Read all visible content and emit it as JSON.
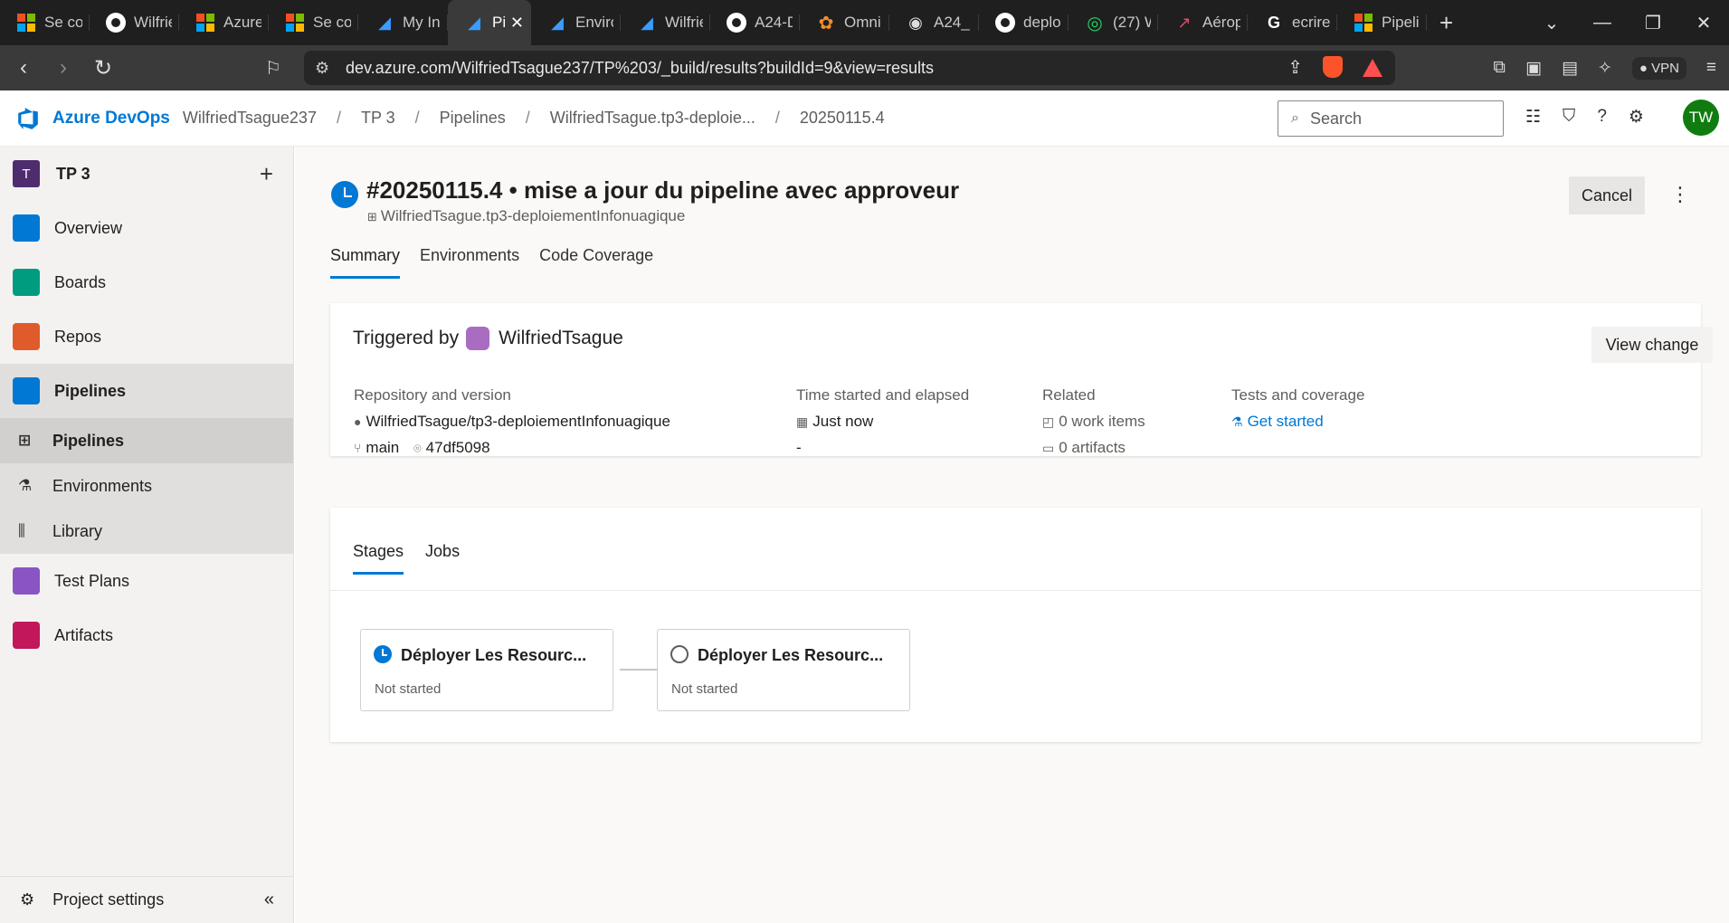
{
  "browser": {
    "tabs": [
      {
        "label": "Se cor",
        "icon": "microsoft-icon"
      },
      {
        "label": "Wilfrie",
        "icon": "github-icon"
      },
      {
        "label": "Azure",
        "icon": "microsoft-icon"
      },
      {
        "label": "Se cor",
        "icon": "microsoft-icon"
      },
      {
        "label": "My In",
        "icon": "azure-devops-icon"
      },
      {
        "label": "Pi",
        "icon": "azure-devops-icon",
        "active": true
      },
      {
        "label": "Enviro",
        "icon": "azure-devops-icon"
      },
      {
        "label": "Wilfrie",
        "icon": "azure-devops-icon"
      },
      {
        "label": "A24-D",
        "icon": "github-icon"
      },
      {
        "label": "Omni",
        "icon": "flower-icon"
      },
      {
        "label": "A24_",
        "icon": "globe-icon"
      },
      {
        "label": "deplo",
        "icon": "github-icon"
      },
      {
        "label": "(27) W",
        "icon": "whatsapp-icon"
      },
      {
        "label": "Aérop",
        "icon": "chart-icon"
      },
      {
        "label": "ecrire",
        "icon": "google-icon"
      },
      {
        "label": "Pipeli",
        "icon": "microsoft-icon"
      }
    ],
    "url": "dev.azure.com/WilfriedTsague237/TP%203/_build/results?buildId=9&view=results",
    "vpn_label": "VPN"
  },
  "header": {
    "brand": "Azure DevOps",
    "breadcrumbs": [
      "WilfriedTsague237",
      "TP 3",
      "Pipelines",
      "WilfriedTsague.tp3-deploie...",
      "20250115.4"
    ],
    "search_placeholder": "Search",
    "avatar_initials": "TW"
  },
  "sidebar": {
    "project_badge": "T",
    "project_name": "TP 3",
    "items": [
      {
        "label": "Overview",
        "color": "#0078d4"
      },
      {
        "label": "Boards",
        "color": "#009c7f"
      },
      {
        "label": "Repos",
        "color": "#e05b2b"
      },
      {
        "label": "Pipelines",
        "color": "#0078d4"
      }
    ],
    "sub_items": [
      {
        "label": "Pipelines"
      },
      {
        "label": "Environments"
      },
      {
        "label": "Library"
      }
    ],
    "items_after": [
      {
        "label": "Test Plans",
        "color": "#8a54c4"
      },
      {
        "label": "Artifacts",
        "color": "#c2185b"
      }
    ],
    "project_settings": "Project settings"
  },
  "run": {
    "title": "#20250115.4 • mise a jour du pipeline avec approveur",
    "pipeline": "WilfriedTsague.tp3-deploiementInfonuagique",
    "cancel_label": "Cancel",
    "tabs": [
      "Summary",
      "Environments",
      "Code Coverage"
    ]
  },
  "summary": {
    "triggered_by_label": "Triggered by",
    "triggered_by": "WilfriedTsague",
    "view_change_label": "View change",
    "repo_heading": "Repository and version",
    "repo": "WilfriedTsague/tp3-deploiementInfonuagique",
    "branch": "main",
    "commit": "47df5098",
    "time_heading": "Time started and elapsed",
    "time_started": "Just now",
    "elapsed": "-",
    "related_heading": "Related",
    "work_items": "0 work items",
    "artifacts": "0 artifacts",
    "tests_heading": "Tests and coverage",
    "tests_link": "Get started"
  },
  "stages": {
    "tabs": [
      "Stages",
      "Jobs"
    ],
    "items": [
      {
        "name": "Déployer Les Resourc...",
        "status": "Not started",
        "state": "running"
      },
      {
        "name": "Déployer Les Resourc...",
        "status": "Not started",
        "state": "pending"
      }
    ]
  }
}
